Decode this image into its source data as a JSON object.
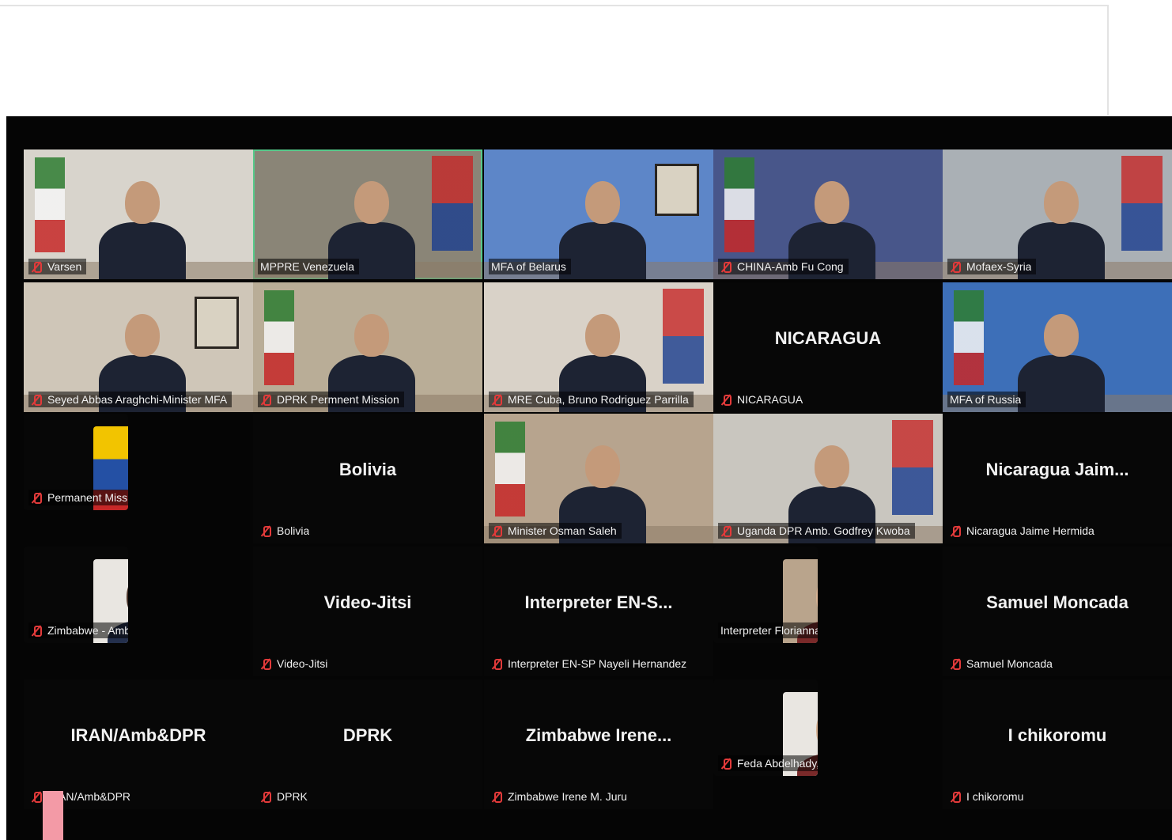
{
  "meeting": {
    "tiles": [
      {
        "name": "Varsen",
        "muted": true,
        "kind": "video",
        "bg": "#d8d4cc"
      },
      {
        "name": "MPPRE Venezuela",
        "muted": false,
        "kind": "video",
        "bg": "#8a8577",
        "active": true
      },
      {
        "name": "MFA of Belarus",
        "muted": false,
        "kind": "video",
        "bg": "#5d86c8"
      },
      {
        "name": "CHINA-Amb Fu Cong",
        "muted": true,
        "kind": "video",
        "bg": "#48568a"
      },
      {
        "name": "Mofaex-Syria",
        "muted": true,
        "kind": "video",
        "bg": "#aab0b5"
      },
      {
        "name": "Seyed Abbas Araghchi-Minister MFA",
        "muted": true,
        "kind": "video",
        "bg": "#cfc6b8"
      },
      {
        "name": "DPRK Permnent Mission",
        "muted": true,
        "kind": "video",
        "bg": "#b9ad97"
      },
      {
        "name": "MRE Cuba, Bruno Rodriguez Parrilla",
        "muted": true,
        "kind": "video",
        "bg": "#d9d2c8"
      },
      {
        "name": "NICARAGUA",
        "muted": true,
        "kind": "blank",
        "display": "NICARAGUA"
      },
      {
        "name": "MFA of Russia",
        "muted": false,
        "kind": "video",
        "bg": "#3d6fb8"
      },
      {
        "name": "Permanent Mission of Venezuela to the ...",
        "muted": true,
        "kind": "avatar"
      },
      {
        "name": "Bolivia",
        "muted": true,
        "kind": "blank",
        "display": "Bolivia"
      },
      {
        "name": "Minister Osman Saleh",
        "muted": true,
        "kind": "video",
        "bg": "#b7a48e"
      },
      {
        "name": "Uganda DPR Amb. Godfrey Kwoba",
        "muted": true,
        "kind": "video",
        "bg": "#c9c6bf"
      },
      {
        "name": "Nicaragua Jaime Hermida",
        "muted": true,
        "kind": "blank",
        "display": "Nicaragua  Jaim..."
      },
      {
        "name": "Zimbabwe - Ambassador Taonga Musha...",
        "muted": true,
        "kind": "avatar"
      },
      {
        "name": "Video-Jitsi",
        "muted": true,
        "kind": "blank",
        "display": "Video-Jitsi"
      },
      {
        "name": "Interpreter EN-SP Nayeli Hernandez",
        "muted": true,
        "kind": "blank",
        "display": "Interpreter  EN-S..."
      },
      {
        "name": "Interpreter Florianna Ramírez",
        "muted": false,
        "kind": "avatar"
      },
      {
        "name": "Samuel Moncada",
        "muted": true,
        "kind": "blank",
        "display": "Samuel Moncada"
      },
      {
        "name": "IRAN/Amb&DPR",
        "muted": true,
        "kind": "blank",
        "display": "IRAN/Amb&DPR"
      },
      {
        "name": "DPRK",
        "muted": true,
        "kind": "blank",
        "display": "DPRK"
      },
      {
        "name": "Zimbabwe Irene M. Juru",
        "muted": true,
        "kind": "blank",
        "display": "Zimbabwe  Irene..."
      },
      {
        "name": "Feda Abdelhady, DPR State of Palestine",
        "muted": true,
        "kind": "avatar"
      },
      {
        "name": "I chikoromu",
        "muted": true,
        "kind": "blank",
        "display": "I chikoromu"
      }
    ]
  },
  "colors": {
    "screen_bg": "#050505",
    "active_border": "#57c98a",
    "muted_icon": "#e23a3a",
    "label_text": "#f0f0f0"
  },
  "icons": {
    "muted": "mic-off-icon"
  }
}
